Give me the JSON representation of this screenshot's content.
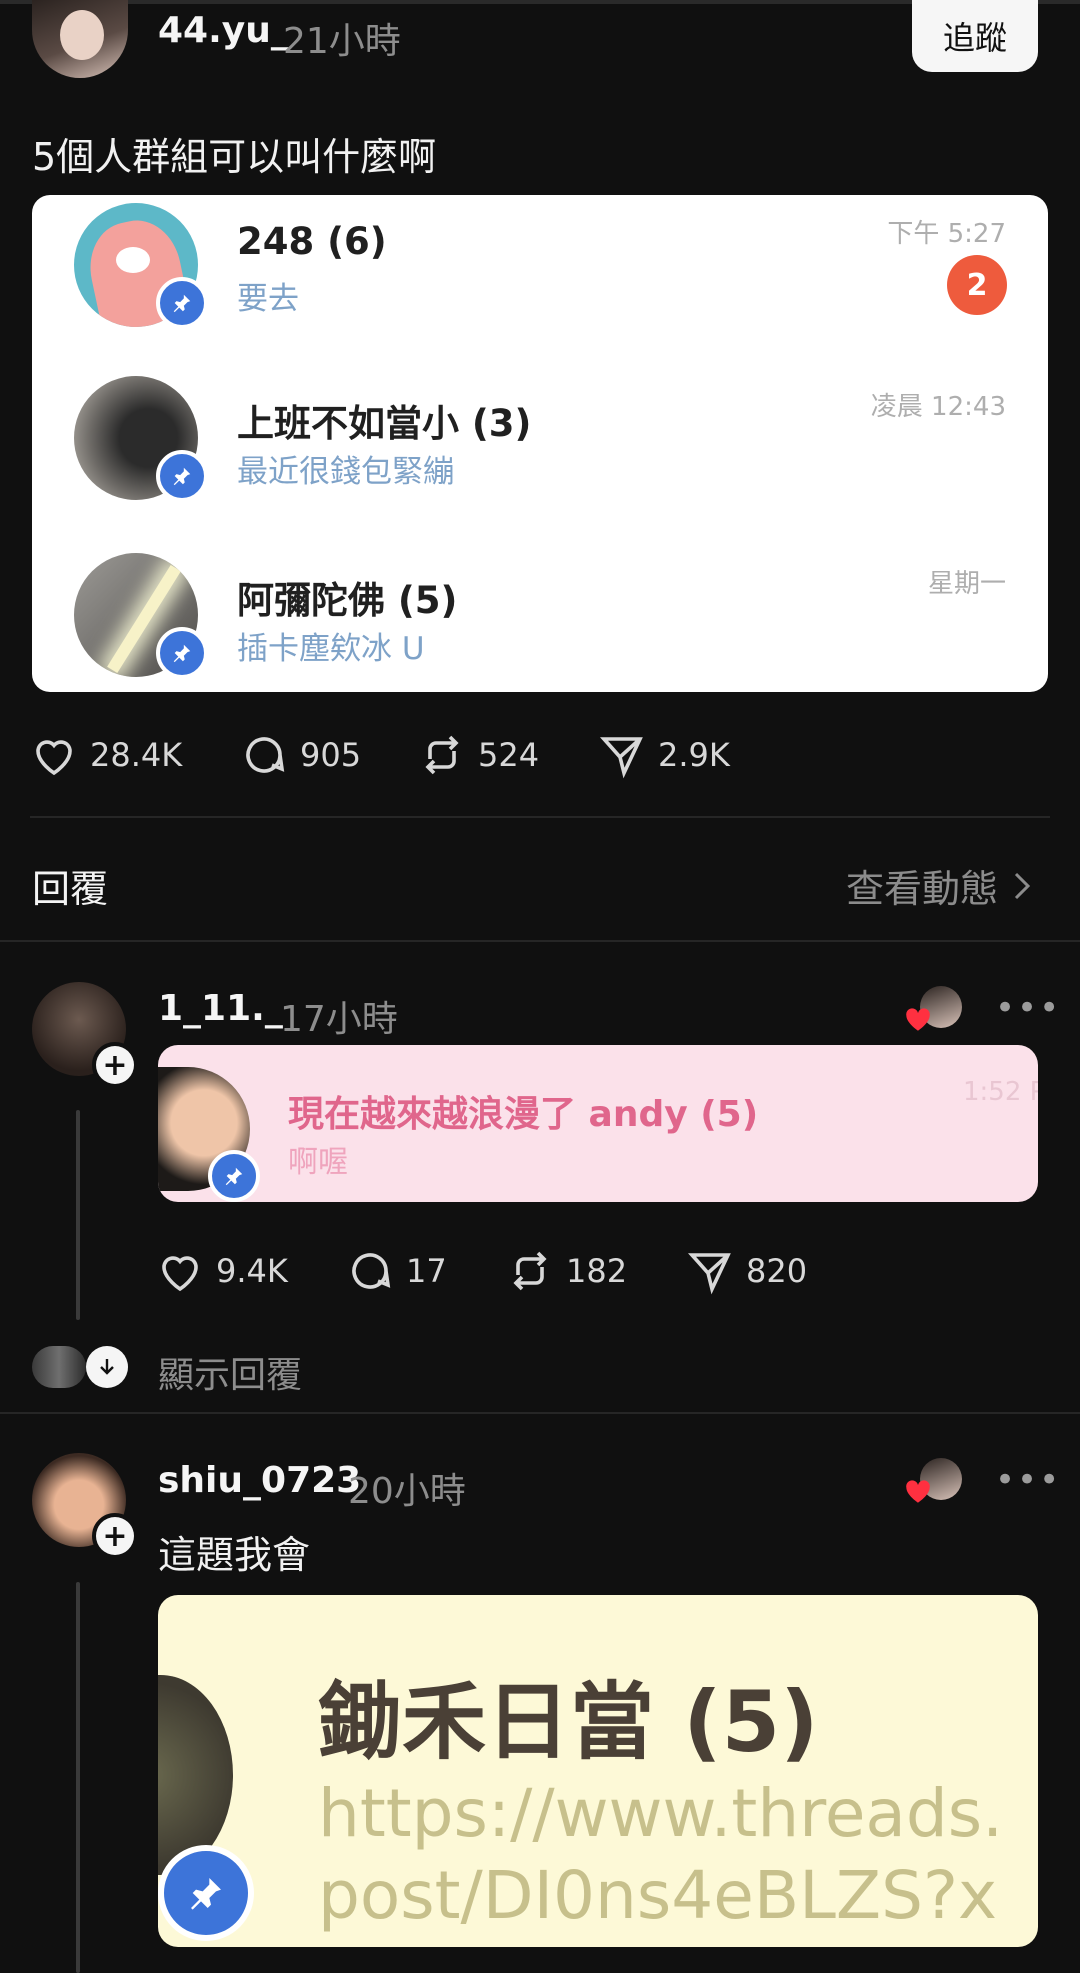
{
  "post": {
    "username": "44.yu_",
    "time": "21小時",
    "follow_label": "追蹤",
    "text": "5個人群組可以叫什麼啊",
    "stats": {
      "likes": "28.4K",
      "comments": "905",
      "reposts": "524",
      "shares": "2.9K"
    }
  },
  "chats": [
    {
      "title": "248 (6)",
      "subtitle": "要去",
      "time": "下午 5:27",
      "unread": "2"
    },
    {
      "title": "上班不如當小 (3)",
      "subtitle": "最近很錢包緊繃",
      "time": "凌晨 12:43"
    },
    {
      "title": "阿彌陀佛 (5)",
      "subtitle": "插卡塵欸冰 U",
      "time": "星期一"
    }
  ],
  "replies_header": {
    "title": "回覆",
    "view_activity": "查看動態"
  },
  "reply1": {
    "username": "1_11._",
    "time": "17小時",
    "card_title": "現在越來越浪漫了 andy (5)",
    "card_subtitle": "啊喔",
    "card_time": "1:52 P",
    "stats": {
      "likes": "9.4K",
      "comments": "17",
      "reposts": "182",
      "shares": "820"
    },
    "show_replies": "顯示回覆"
  },
  "reply2": {
    "username": "shiu_0723",
    "time": "20小時",
    "text": "這題我會",
    "card_title": "鋤禾日當 (5)",
    "card_line1": "https://www.threads.",
    "card_line2": "post/DI0ns4eBLZS?x"
  },
  "colors": {
    "bg": "#101010",
    "pin": "#3d74d9",
    "unread": "#ee5b3d",
    "pink": "#fbe1ea",
    "yellow": "#fdf9d7"
  },
  "icons": [
    "heart-icon",
    "comment-icon",
    "repost-icon",
    "share-icon",
    "pin-icon",
    "plus-icon",
    "more-icon",
    "chevron-right-icon",
    "arrow-down-icon"
  ]
}
